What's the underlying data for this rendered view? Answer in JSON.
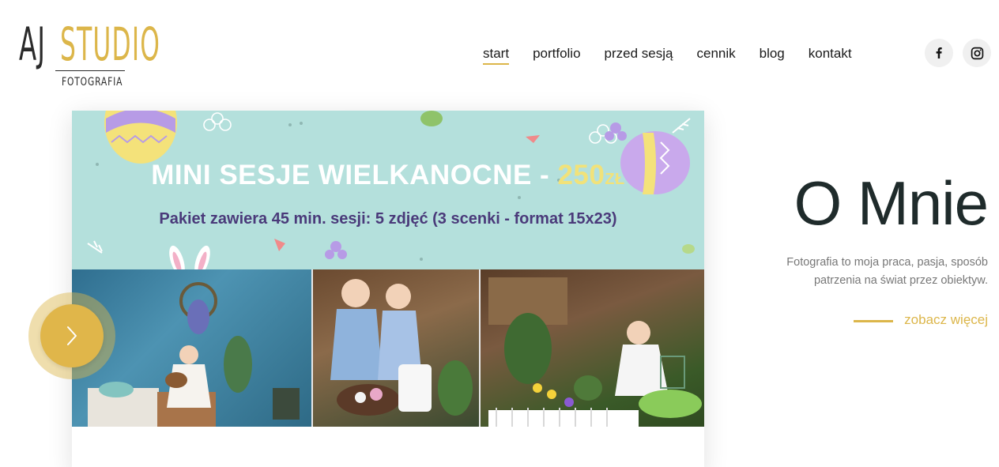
{
  "logo": {
    "part1": "AJ",
    "part2": "STUDIO",
    "subtitle": "FOTOGRAFIA"
  },
  "nav": {
    "items": [
      {
        "label": "start",
        "active": true
      },
      {
        "label": "portfolio"
      },
      {
        "label": "przed sesją"
      },
      {
        "label": "cennik"
      },
      {
        "label": "blog"
      },
      {
        "label": "kontakt"
      }
    ]
  },
  "social": {
    "facebook_icon": "facebook-icon",
    "instagram_icon": "instagram-icon"
  },
  "slide": {
    "title_prefix": "MINI SESJE WIELKANOCNE - ",
    "price": "250",
    "currency": "ZŁ",
    "subtitle": "Pakiet zawiera 45 min. sesji: 5 zdjęć (3 scenki - format 15x23)",
    "next_icon": "chevron-right-icon"
  },
  "about": {
    "title": "O Mnie",
    "text": "Fotografia to moja praca, pasja, sposób patrzenia na świat przez obiektyw.",
    "link": "zobacz więcej"
  },
  "colors": {
    "accent": "#dcb64a",
    "banner_bg": "#b4e0dc",
    "banner_text": "#4a3a7a"
  }
}
